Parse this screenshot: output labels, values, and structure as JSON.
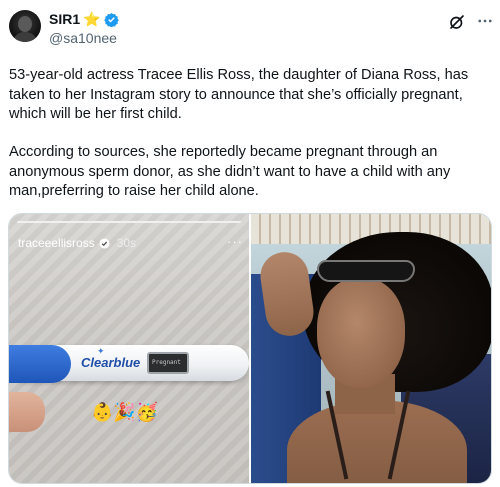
{
  "author": {
    "display_name": "SIR1",
    "star": "⭐",
    "handle": "@sa10nee"
  },
  "post": {
    "paragraph_1": "53-year-old actress Tracee Ellis Ross, the daughter of Diana Ross, has taken to her Instagram story to announce that she’s officially pregnant, which will be her first child.",
    "paragraph_2": "According to sources, she reportedly became pregnant through an anonymous sperm donor, as she didn’t want to have a child with any man,preferring to raise her child alone."
  },
  "media": {
    "left_image": {
      "story_username": "traceeellisross",
      "story_time": "30s",
      "story_more": "···",
      "test_brand": "Clearblue",
      "test_window_text": "Pregnant",
      "emojis": "👶🎉🥳"
    },
    "right_image": {}
  },
  "colors": {
    "handle": "#536471",
    "verified": "#1d9bf0",
    "star": "#f5b301",
    "test_cap": "#1f56b8"
  },
  "icons": [
    "avatar",
    "verified-badge-icon",
    "grok-icon",
    "more-options-icon",
    "story-verified-icon"
  ]
}
